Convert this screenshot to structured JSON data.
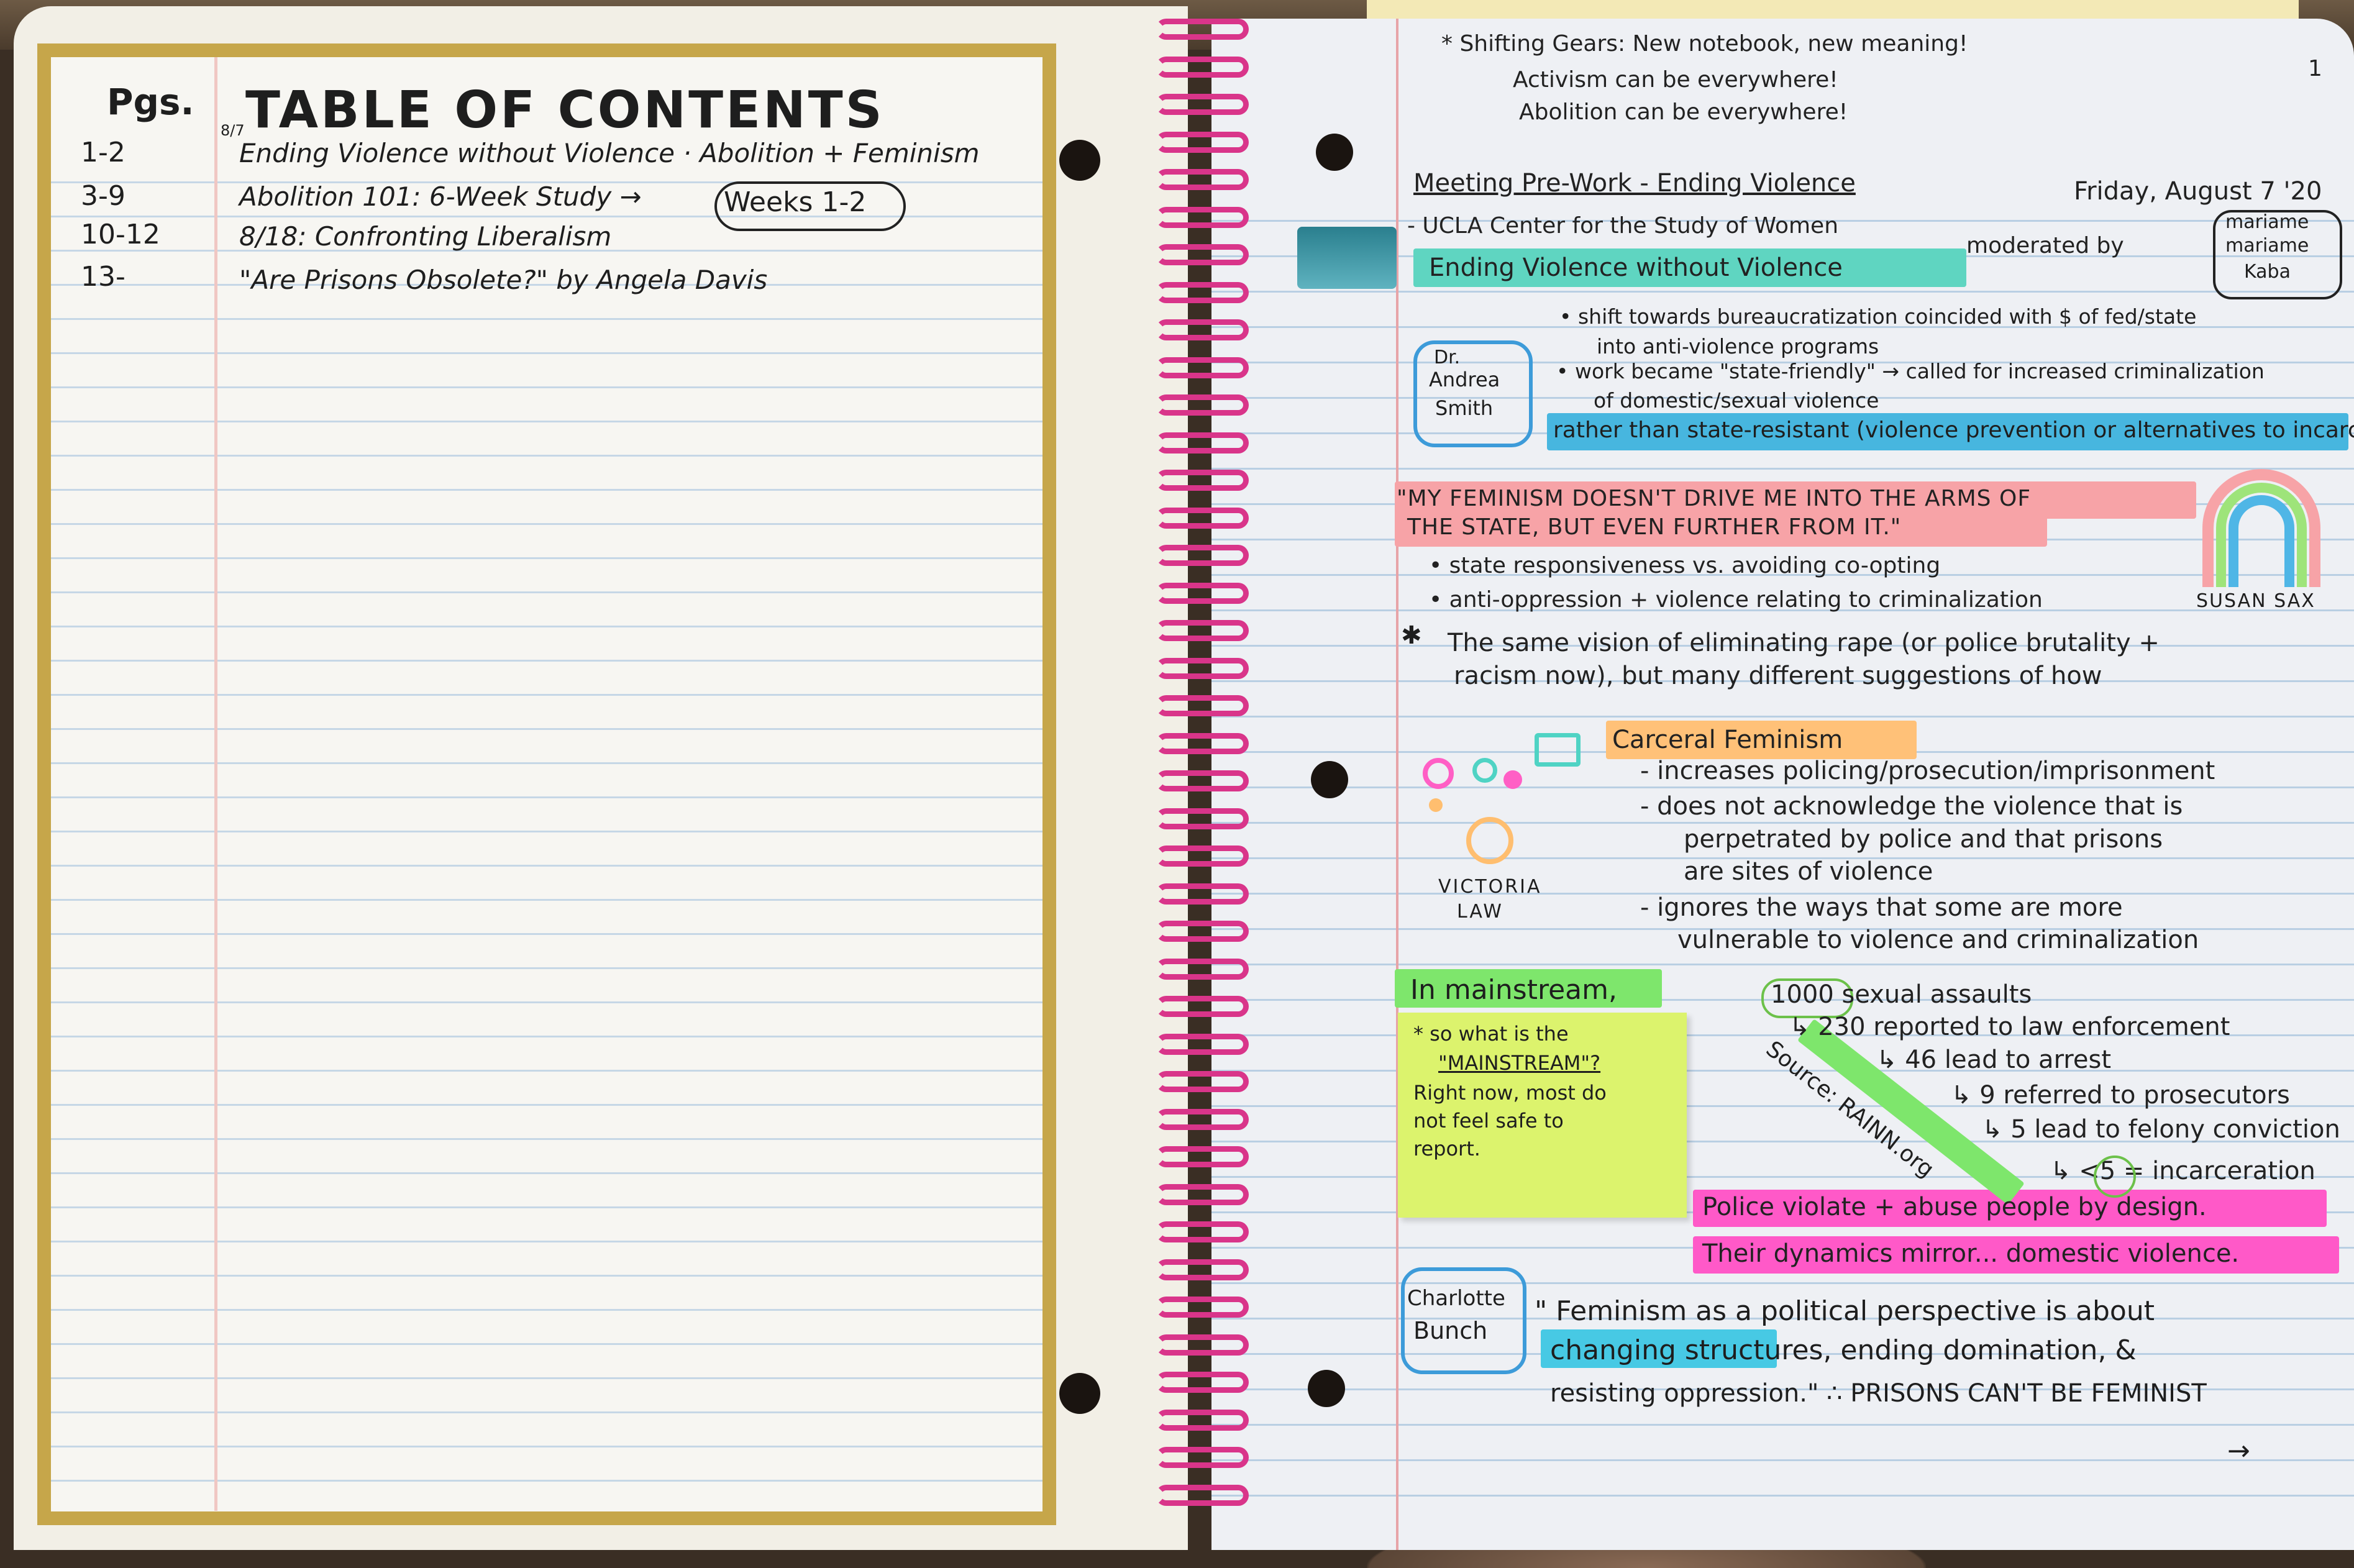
{
  "left_page": {
    "pages_header": "Pgs.",
    "title": "TABLE OF CONTENTS",
    "date_note": "8/7",
    "entries": [
      {
        "pages": "1-2",
        "title": "Ending Violence without Violence · Abolition + Feminism"
      },
      {
        "pages": "3-9",
        "title": "Abolition 101: 6-Week Study →"
      },
      {
        "pages": "10-12",
        "title": "8/18: Confronting Liberalism"
      },
      {
        "pages": "13-",
        "title": "\"Are Prisons Obsolete?\" by Angela Davis"
      }
    ],
    "weeks_note": "Weeks 1-2"
  },
  "right_page": {
    "page_number": "1",
    "intro": [
      "* Shifting Gears: New notebook, new meaning!",
      "Activism can be everywhere!",
      "Abolition can be everywhere!"
    ],
    "meeting_title": "Meeting Pre-Work - Ending Violence",
    "date": "Friday, August 7 '20",
    "host": "- UCLA Center for the Study of Women",
    "moderated_by": "moderated by",
    "moderator_box": [
      "mariame",
      "mariame",
      "Kaba"
    ],
    "event_title": "Ending Violence without Violence",
    "speaker1": [
      "Dr.",
      "Andrea",
      "Smith"
    ],
    "speaker1_notes": [
      "• shift towards bureaucratization coincided with $ of fed/state",
      "into anti-violence programs",
      "• work became \"state-friendly\" → called for increased criminalization",
      "of domestic/sexual violence"
    ],
    "rather_than": "rather than state-resistant (violence prevention or alternatives to incarceration)",
    "quote": [
      "\"MY FEMINISM DOESN'T DRIVE ME INTO THE ARMS OF",
      "THE STATE, BUT EVEN FURTHER FROM IT.\""
    ],
    "quote_author": "SUSAN SAX",
    "quote_notes": [
      "• state responsiveness vs. avoiding co-opting",
      "• anti-oppression + violence relating to criminalization"
    ],
    "vision": [
      "The same vision of eliminating rape (or police brutality +",
      "racism now), but many different suggestions of how"
    ],
    "carceral_heading": "Carceral Feminism",
    "carceral_author": [
      "VICTORIA",
      "LAW"
    ],
    "carceral_notes": [
      "- increases policing/prosecution/imprisonment",
      "- does not acknowledge the violence that is",
      "perpetrated by police and that prisons",
      "are sites of violence",
      "- ignores the ways that some are more",
      "vulnerable to violence and criminalization"
    ],
    "mainstream_heading": "In mainstream,",
    "sticky_note": [
      "* so what is the",
      "\"MAINSTREAM\"?",
      "Right now, most do",
      "not feel safe to",
      "report."
    ],
    "stats": [
      "1000 sexual assaults",
      "↳ 230 reported to law enforcement",
      "↳ 46 lead to arrest",
      "↳ 9 referred to prosecutors",
      "↳ 5 lead to felony conviction",
      "↳ <5 = incarceration"
    ],
    "source": "Source: RAINN.org",
    "police_line": "Police violate + abuse people by design.",
    "dynamics_line": "Their dynamics mirror... domestic violence.",
    "speaker2": [
      "Charlotte",
      "Bunch"
    ],
    "feminism_quote": [
      "\" Feminism as a political perspective is about",
      "changing structures, ending domination, &",
      "resisting oppression.\" ∴ PRISONS CAN'T BE FEMINIST"
    ],
    "continue_arrow": "→"
  },
  "colors": {
    "teal_highlight": "#5fd5c1",
    "blue_highlight": "#47b6df",
    "pink_highlight": "#f7a3a7",
    "orange_highlight": "#ffc178",
    "green_highlight": "#7ee66c",
    "magenta_highlight": "#ff59c8",
    "gold_frame": "#c6a64a",
    "spiral": "#d9358a"
  }
}
